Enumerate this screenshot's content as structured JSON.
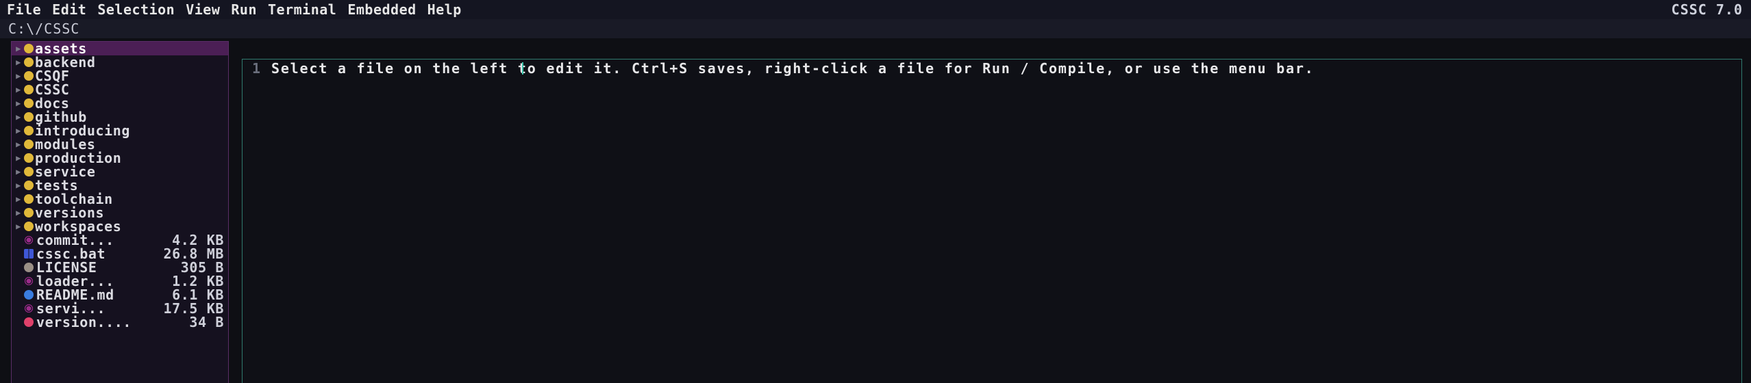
{
  "menu": {
    "items": [
      "File",
      "Edit",
      "Selection",
      "View",
      "Run",
      "Terminal",
      "Embedded",
      "Help"
    ],
    "app_version": "CSSC 7.0"
  },
  "path": "C:\\/CSSC",
  "tree": {
    "folders": [
      {
        "name": "assets",
        "selected": true,
        "color": "#e0b83a"
      },
      {
        "name": "backend",
        "color": "#e0b83a"
      },
      {
        "name": "CSQF",
        "color": "#e0b83a"
      },
      {
        "name": "CSSC",
        "color": "#e0b83a"
      },
      {
        "name": "docs",
        "color": "#e0b83a"
      },
      {
        "name": "github",
        "color": "#e0b83a"
      },
      {
        "name": "introducing",
        "color": "#e0b83a"
      },
      {
        "name": "modules",
        "color": "#e0b83a"
      },
      {
        "name": "production",
        "color": "#e0b83a"
      },
      {
        "name": "service",
        "color": "#e0b83a"
      },
      {
        "name": "tests",
        "color": "#e0b83a"
      },
      {
        "name": "toolchain",
        "color": "#e0b83a"
      },
      {
        "name": "versions",
        "color": "#e0b83a"
      },
      {
        "name": "workspaces",
        "color": "#e0b83a"
      }
    ],
    "files": [
      {
        "name": "commit...",
        "size": "4.2 KB",
        "icon": "gear-icon",
        "color": "#9b2b8a"
      },
      {
        "name": "cssc.bat",
        "size": "26.8 MB",
        "icon": "windows-icon",
        "color": "#3f57d6"
      },
      {
        "name": "LICENSE",
        "size": "305 B",
        "icon": "license-icon",
        "color": "#9a8f86"
      },
      {
        "name": "loader...",
        "size": "1.2 KB",
        "icon": "gear-icon",
        "color": "#9b2b8a"
      },
      {
        "name": "README.md",
        "size": "6.1 KB",
        "icon": "info-icon",
        "color": "#3a7de0"
      },
      {
        "name": "servi...",
        "size": "17.5 KB",
        "icon": "gear-icon",
        "color": "#9b2b8a"
      },
      {
        "name": "version....",
        "size": "34 B",
        "icon": "database-icon",
        "color": "#e0416b"
      }
    ]
  },
  "editor": {
    "line_number": "1",
    "text": "Select a file on the left to edit it. Ctrl+S saves, right-click a file for Run / Compile, or use the menu bar."
  }
}
